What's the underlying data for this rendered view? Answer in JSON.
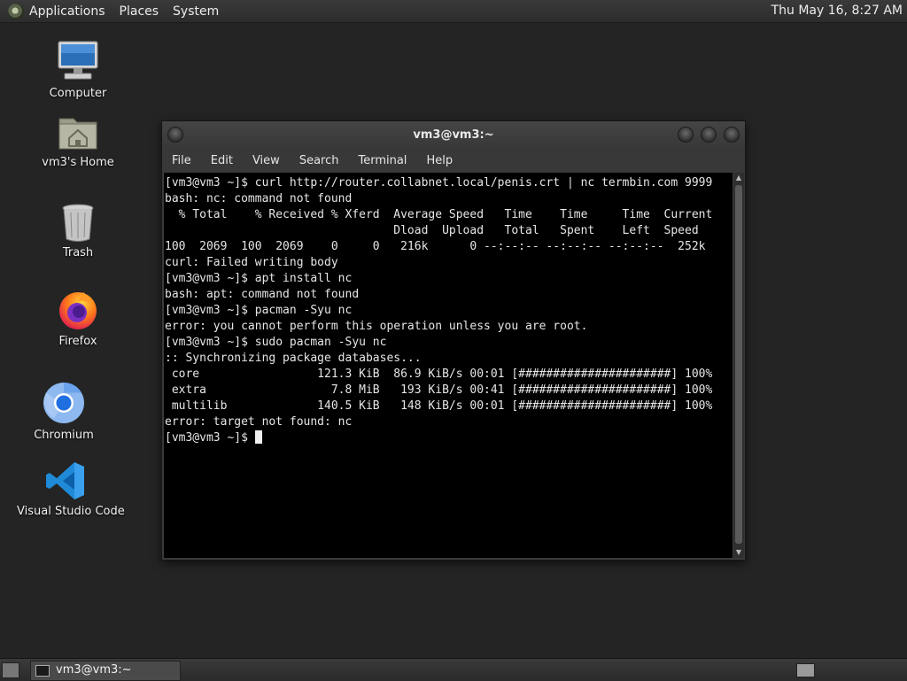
{
  "top_panel": {
    "menus": [
      "Applications",
      "Places",
      "System"
    ],
    "clock": "Thu May 16,  8:27 AM"
  },
  "desktop": {
    "icons": [
      {
        "label": "Computer",
        "icon": "computer-icon"
      },
      {
        "label": "vm3's Home",
        "icon": "home-folder-icon"
      },
      {
        "label": "Trash",
        "icon": "trash-icon"
      },
      {
        "label": "Firefox",
        "icon": "firefox-icon"
      },
      {
        "label": "Chromium",
        "icon": "chromium-icon"
      },
      {
        "label": "Visual Studio Code",
        "icon": "vscode-icon"
      }
    ]
  },
  "terminal": {
    "title": "vm3@vm3:~",
    "menu": [
      "File",
      "Edit",
      "View",
      "Search",
      "Terminal",
      "Help"
    ],
    "lines": [
      "[vm3@vm3 ~]$ curl http://router.collabnet.local/penis.crt | nc termbin.com 9999",
      "bash: nc: command not found",
      "  % Total    % Received % Xferd  Average Speed   Time    Time     Time  Current",
      "                                 Dload  Upload   Total   Spent    Left  Speed",
      "100  2069  100  2069    0     0   216k      0 --:--:-- --:--:-- --:--:--  252k",
      "curl: Failed writing body",
      "[vm3@vm3 ~]$ apt install nc",
      "bash: apt: command not found",
      "[vm3@vm3 ~]$ pacman -Syu nc",
      "error: you cannot perform this operation unless you are root.",
      "[vm3@vm3 ~]$ sudo pacman -Syu nc",
      ":: Synchronizing package databases...",
      " core                 121.3 KiB  86.9 KiB/s 00:01 [######################] 100%",
      " extra                  7.8 MiB   193 KiB/s 00:41 [######################] 100%",
      " multilib             140.5 KiB   148 KiB/s 00:01 [######################] 100%",
      "error: target not found: nc"
    ],
    "prompt": "[vm3@vm3 ~]$ "
  },
  "taskbar": {
    "task_label": "vm3@vm3:~"
  }
}
